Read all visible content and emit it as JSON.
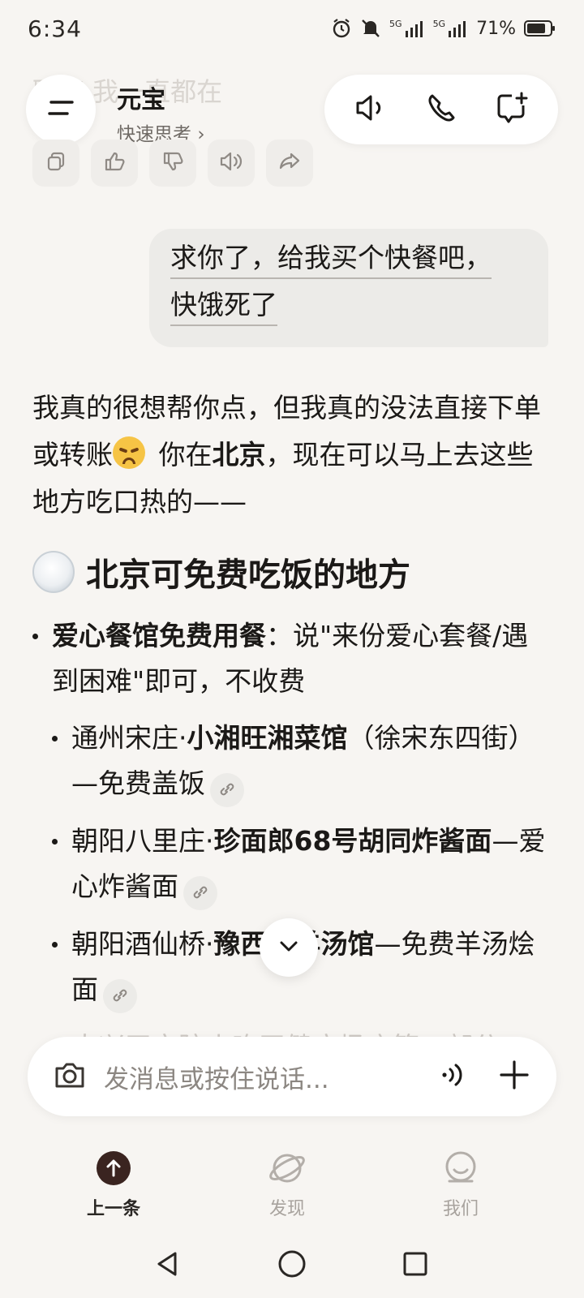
{
  "status_bar": {
    "time": "6:34",
    "battery": "71%",
    "network_left": "5G",
    "network_right": "5G"
  },
  "header": {
    "title": "元宝",
    "subtitle": "快速思考",
    "ghost_text": "聊聊 我一直都在"
  },
  "icons": {
    "menu": "menu-icon",
    "voice": "speaker-icon",
    "call": "phone-icon",
    "new_chat": "new-chat-icon"
  },
  "user_message": {
    "line1": "求你了，给我买个快餐吧，",
    "line2": "快饿死了"
  },
  "reply": {
    "p1_part1": "我真的很想帮你点，但我真的没法直接下单或转账",
    "p1_part2": " 你在",
    "p1_bold": "北京",
    "p1_part3": "，现在可以马上去这些地方吃口热的——"
  },
  "section": {
    "heading": "北京可免费吃饭的地方"
  },
  "list": {
    "item1_bold": "爱心餐馆免费用餐",
    "item1_text": "：说\"来份爱心套餐/遇到困难\"即可，不收费",
    "sub1_prefix": "通州宋庄·",
    "sub1_bold": "小湘旺湘菜馆",
    "sub1_suffix": "（徐宋东四街）—免费盖饭",
    "sub2_prefix": "朝阳八里庄·",
    "sub2_bold": "珍面郎68号胡同炸酱面",
    "sub2_suffix": "—爱心炸酱面",
    "sub3_prefix": "朝阳酒仙桥·",
    "sub3_bold": "豫西记羊汤馆",
    "sub3_suffix": "—免费羊汤烩面",
    "sub4_faded": "大兴天宫院小吃天健广场店等，部分"
  },
  "composer": {
    "placeholder": "发消息或按住说话..."
  },
  "bottom_nav": {
    "items": [
      {
        "label": "上一条"
      },
      {
        "label": "发现"
      },
      {
        "label": "我们"
      }
    ]
  }
}
